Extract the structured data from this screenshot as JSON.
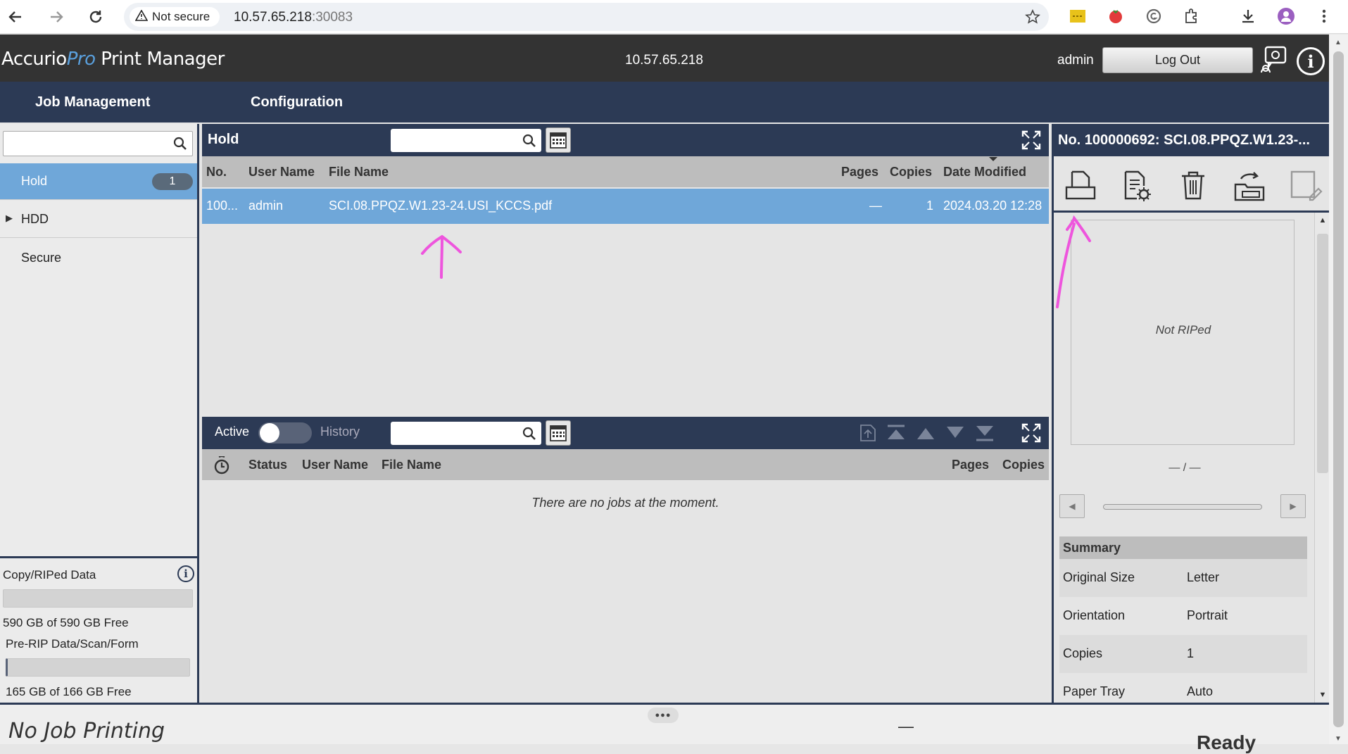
{
  "browser": {
    "security_label": "Not secure",
    "url_host": "10.57.65.218",
    "url_port": ":30083"
  },
  "header": {
    "logo_part1": "Accurio",
    "logo_part2": "Pro",
    "logo_part3": " Print Manager",
    "host": "10.57.65.218",
    "user": "admin",
    "logout_label": "Log Out"
  },
  "nav": {
    "tabs": [
      "Job Management",
      "Configuration"
    ]
  },
  "sidebar": {
    "search_placeholder": "",
    "items": [
      {
        "label": "Hold",
        "count": "1",
        "selected": true
      },
      {
        "label": "HDD"
      },
      {
        "label": "Secure"
      }
    ],
    "storage": [
      {
        "label": "Copy/RIPed Data",
        "free_text": "590 GB of 590 GB Free",
        "used_fraction": 0.0
      },
      {
        "label": "Pre-RIP Data/Scan/Form",
        "free_text": "165 GB of 166 GB Free",
        "used_fraction": 0.006
      }
    ]
  },
  "hold_panel": {
    "title": "Hold",
    "columns": [
      "No.",
      "User Name",
      "File Name",
      "Pages",
      "Copies",
      "Date Modified"
    ],
    "rows": [
      {
        "no": "100...",
        "user": "admin",
        "file": "SCI.08.PPQZ.W1.23-24.USI_KCCS.pdf",
        "pages": "—",
        "copies": "1",
        "date": "2024.03.20 12:28"
      }
    ]
  },
  "active_panel": {
    "active_label": "Active",
    "history_label": "History",
    "columns": [
      "Status",
      "User Name",
      "File Name",
      "Pages",
      "Copies"
    ],
    "empty_message": "There are no jobs at the moment."
  },
  "detail_panel": {
    "title": "No. 100000692: SCI.08.PPQZ.W1.23-...",
    "preview_text": "Not RIPed",
    "page_counter": "— / —",
    "summary_title": "Summary",
    "summary": [
      {
        "key": "Original Size",
        "value": "Letter"
      },
      {
        "key": "Orientation",
        "value": "Portrait"
      },
      {
        "key": "Copies",
        "value": "1"
      },
      {
        "key": "Paper Tray",
        "value": "Auto"
      }
    ]
  },
  "status_bar": {
    "printing_status": "No Job Printing",
    "dash": "—",
    "ready": "Ready"
  },
  "colors": {
    "nav_bg": "#2c3a55",
    "header_bg": "#333333",
    "selected_row": "#6fa7d9",
    "annotation": "#ee55dd"
  }
}
